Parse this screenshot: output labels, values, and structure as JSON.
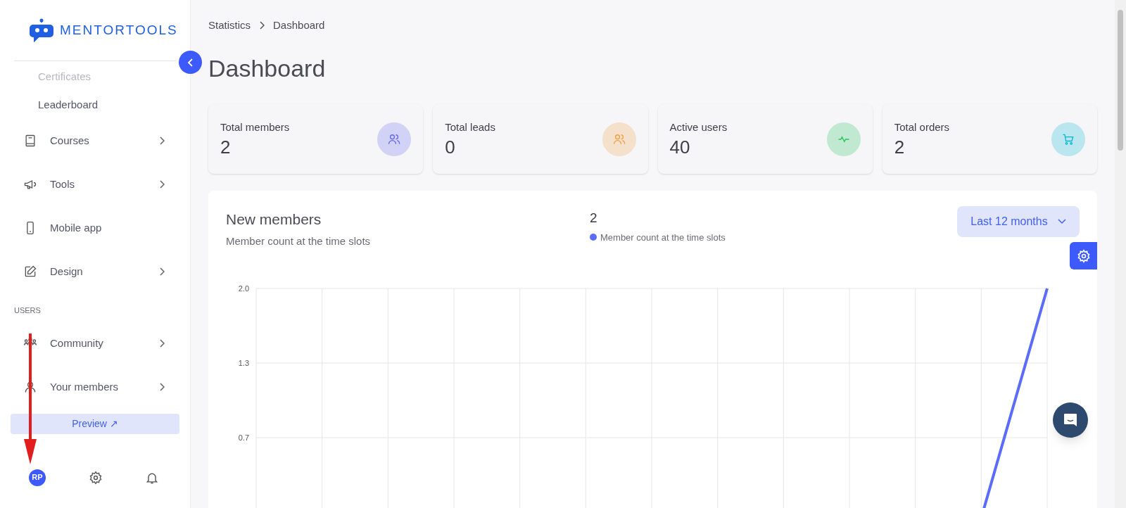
{
  "brand": {
    "name": "MENTORTOOLS"
  },
  "sidebar": {
    "items": [
      {
        "kind": "subitem",
        "label": "Certificates"
      },
      {
        "kind": "subitem",
        "label": "Leaderboard"
      },
      {
        "kind": "item",
        "label": "Courses",
        "expandable": true
      },
      {
        "kind": "item",
        "label": "Tools",
        "expandable": true
      },
      {
        "kind": "item",
        "label": "Mobile app",
        "expandable": false
      },
      {
        "kind": "item",
        "label": "Design",
        "expandable": true
      },
      {
        "kind": "section",
        "label": "USERS"
      },
      {
        "kind": "item",
        "label": "Community",
        "expandable": true
      },
      {
        "kind": "item",
        "label": "Your members",
        "expandable": true
      }
    ],
    "preview_button": "Preview ↗",
    "avatar": "RP"
  },
  "breadcrumb": [
    "Statistics",
    "Dashboard"
  ],
  "title": "Dashboard",
  "stats": [
    {
      "label": "Total members",
      "value": "2",
      "color": "#6366f1"
    },
    {
      "label": "Total leads",
      "value": "0",
      "color": "#f59e42"
    },
    {
      "label": "Active users",
      "value": "40",
      "color": "#22c55e"
    },
    {
      "label": "Total orders",
      "value": "2",
      "color": "#06b6d4"
    }
  ],
  "new_members": {
    "title": "New members",
    "subtitle": "Member count at the time slots",
    "total": "2",
    "range": "Last 12 months",
    "legend": {
      "label": "Member count at the time slots",
      "color": "#5b6cf9"
    },
    "y_axis_labels": [
      "2.0",
      "1.3",
      "0.7"
    ]
  }
}
